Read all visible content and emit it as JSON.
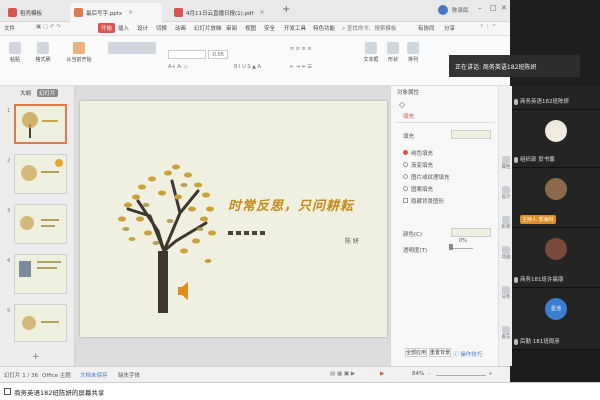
{
  "tabs": [
    {
      "label": "稻壳模板",
      "color": "#d9534f",
      "active": false
    },
    {
      "label": "最后写字.pptx",
      "color": "#e07a4a",
      "active": true
    },
    {
      "label": "4月11日云直播日报(1).pdf",
      "color": "#d9534f",
      "active": false
    }
  ],
  "title_user": "陈承民",
  "menu": {
    "file": "文件",
    "items": [
      "开始",
      "插入",
      "设计",
      "切换",
      "动画",
      "幻灯片放映",
      "审阅",
      "视图",
      "安全",
      "开发工具",
      "特色功能"
    ],
    "selected_index": 0,
    "search_placeholder": "查找命令、搜索模板",
    "right": [
      "有协同",
      "分享"
    ]
  },
  "ribbon": {
    "paste": "粘贴",
    "format_painter": "格式刷",
    "from_current": "从当前开始",
    "font_size": "-0.05",
    "right_buttons": [
      "文本框",
      "形状",
      "排列",
      "图片",
      "插入"
    ]
  },
  "left_panel": {
    "outline": "大纲",
    "slides_tab": "幻灯片",
    "slide_numbers": [
      "1",
      "2",
      "3",
      "4",
      "5"
    ]
  },
  "slide": {
    "title": "时常反思，只问耕耘",
    "author": "陈 妍"
  },
  "properties": {
    "header": "对象属性",
    "fill_section": "填充",
    "fill_label": "填充",
    "options": [
      "纯色填充",
      "渐变填充",
      "图片或纹理填充",
      "图案填充",
      "隐藏背景图形"
    ],
    "color_label": "颜色(C)",
    "transparency_label": "透明度(T)",
    "transparency_value": "0%",
    "apply_all": "全部应用",
    "reset_bg": "重置背景",
    "doc_tip": "操作技巧"
  },
  "vtools": [
    "属性",
    "设计",
    "形状",
    "动画",
    "分析",
    "备忘"
  ],
  "status": {
    "slide_info": "幻灯片 1 / 36",
    "theme": "Office 主题",
    "repair": "文档未保存",
    "font_missing": "缺失字体",
    "zoom": "84%"
  },
  "share_text": "商务英语182班陈妍的屏幕共享",
  "meeting": {
    "speaking_label": "正在讲话: 商务英语182班陈妍",
    "participants": [
      {
        "name": "商务英语182班陈妍",
        "avatar_color": "#3a3a3a",
        "host": false
      },
      {
        "name": "组织部 贺书馨",
        "avatar_color": "#f1eadf",
        "host": false
      },
      {
        "name": "主持人 郭海林",
        "avatar_color": "#8a6a4a",
        "host": true
      },
      {
        "name": "商务181班许晨康",
        "avatar_color": "#7a4a3a",
        "host": false
      },
      {
        "name": "后勤 181班周彦",
        "avatar_color": "#3c7fd1",
        "host": false
      }
    ],
    "avatar_text_5": "星池"
  }
}
